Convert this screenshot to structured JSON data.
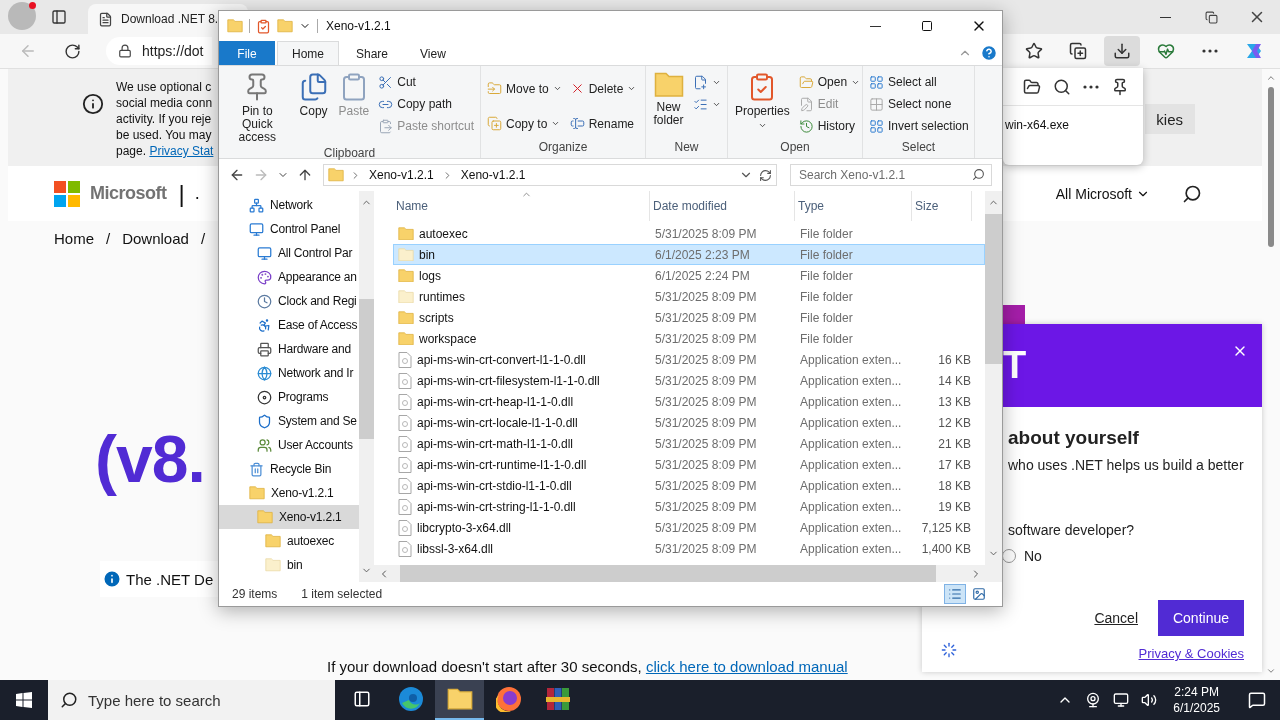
{
  "browser": {
    "tab_title": "Download .NET 8.",
    "url": "https://dot",
    "downloads_open": true
  },
  "downloads_flyout": {
    "file": "win-x64.exe"
  },
  "cookie_banner": {
    "lines": [
      "We use optional c",
      "social media conn",
      "activity. If you reje",
      "be used. You may"
    ],
    "last_line": "page. ",
    "link": "Privacy Stat",
    "button": "kies"
  },
  "site_header": {
    "brand": "Microsoft",
    "divider": "|",
    "product": ".",
    "menu": "All Microsoft"
  },
  "breadcrumb": [
    {
      "label": "Home"
    },
    {
      "label": "Download"
    }
  ],
  "breadcrumb_separator": "/",
  "hero": "(v8.",
  "notice": "The .NET De",
  "download_hint": {
    "text": "If your download doesn't start after 30 seconds, ",
    "link": "click here to download manual"
  },
  "survey": {
    "header": "T",
    "title": "about yourself",
    "intro": "who uses .NET helps us build a better",
    "question": "software developer?",
    "options": [
      {
        "label": "No",
        "selected": false
      }
    ],
    "cancel": "Cancel",
    "continue": "Continue",
    "privacy": "Privacy & Cookies"
  },
  "explorer": {
    "title": "Xeno-v1.2.1",
    "ribbon_tabs": [
      {
        "label": "File",
        "kind": "file",
        "selected": false
      },
      {
        "label": "Home",
        "kind": "tab",
        "selected": true
      },
      {
        "label": "Share",
        "kind": "tab",
        "selected": false
      },
      {
        "label": "View",
        "kind": "tab",
        "selected": false
      }
    ],
    "ribbon_groups": [
      {
        "label": "Clipboard",
        "items": [
          {
            "label": "Pin to Quick access",
            "kind": "large",
            "disabled": false
          },
          {
            "label": "Copy",
            "kind": "large",
            "disabled": false
          },
          {
            "label": "Paste",
            "kind": "large",
            "disabled": true
          },
          {
            "label": "Cut",
            "kind": "small",
            "disabled": false
          },
          {
            "label": "Copy path",
            "kind": "small",
            "disabled": false
          },
          {
            "label": "Paste shortcut",
            "kind": "small",
            "disabled": true
          }
        ]
      },
      {
        "label": "Organize",
        "items": [
          {
            "label": "Move to",
            "kind": "small",
            "disabled": false,
            "dropdown": true
          },
          {
            "label": "Copy to",
            "kind": "small",
            "disabled": false,
            "dropdown": true
          },
          {
            "label": "Delete",
            "kind": "small",
            "disabled": false,
            "dropdown": true
          },
          {
            "label": "Rename",
            "kind": "small",
            "disabled": false
          }
        ]
      },
      {
        "label": "New",
        "items": [
          {
            "label": "New folder",
            "kind": "large",
            "disabled": false
          },
          {
            "kind": "icon",
            "disabled": false,
            "dropdown": true
          },
          {
            "kind": "icon",
            "disabled": false,
            "dropdown": true
          }
        ]
      },
      {
        "label": "Open",
        "items": [
          {
            "label": "Properties",
            "kind": "large",
            "disabled": false,
            "dropdown": true
          },
          {
            "label": "Open",
            "kind": "small",
            "disabled": false,
            "dropdown": true
          },
          {
            "label": "Edit",
            "kind": "small",
            "disabled": true
          },
          {
            "label": "History",
            "kind": "small",
            "disabled": false
          }
        ]
      },
      {
        "label": "Select",
        "items": [
          {
            "label": "Select all",
            "kind": "small",
            "disabled": false
          },
          {
            "label": "Select none",
            "kind": "small",
            "disabled": false
          },
          {
            "label": "Invert selection",
            "kind": "small",
            "disabled": false
          }
        ]
      }
    ],
    "path": [
      "Xeno-v1.2.1",
      "Xeno-v1.2.1"
    ],
    "search_placeholder": "Search Xeno-v1.2.1",
    "nav": [
      {
        "label": "Network",
        "kind": "network",
        "selected": false
      },
      {
        "label": "Control Panel",
        "kind": "panel",
        "selected": false,
        "children": [
          {
            "label": "All Control Par",
            "kind": "panel",
            "selected": false
          },
          {
            "label": "Appearance an",
            "kind": "appearance",
            "selected": false
          },
          {
            "label": "Clock and Regi",
            "kind": "clock",
            "selected": false
          },
          {
            "label": "Ease of Access",
            "kind": "access",
            "selected": false
          },
          {
            "label": "Hardware and",
            "kind": "hardware",
            "selected": false
          },
          {
            "label": "Network and Ir",
            "kind": "internet",
            "selected": false
          },
          {
            "label": "Programs",
            "kind": "programs",
            "selected": false
          },
          {
            "label": "System and Se",
            "kind": "security",
            "selected": false
          },
          {
            "label": "User Accounts",
            "kind": "users",
            "selected": false
          }
        ]
      },
      {
        "label": "Recycle Bin",
        "kind": "recycle",
        "selected": false
      },
      {
        "label": "Xeno-v1.2.1",
        "kind": "folder",
        "selected": false,
        "hidden": false,
        "children": [
          {
            "label": "Xeno-v1.2.1",
            "kind": "folder",
            "selected": true,
            "hidden": false,
            "children": [
              {
                "label": "autoexec",
                "kind": "folder",
                "selected": false,
                "hidden": false
              },
              {
                "label": "bin",
                "kind": "folder",
                "selected": false,
                "hidden": true
              }
            ]
          }
        ]
      }
    ],
    "columns": [
      {
        "label": "Name",
        "sorted": true
      },
      {
        "label": "Date modified",
        "sorted": false
      },
      {
        "label": "Type",
        "sorted": false
      },
      {
        "label": "Size",
        "sorted": false
      }
    ],
    "files": [
      {
        "name": "autoexec",
        "date": "5/31/2025 8:09 PM",
        "type": "File folder",
        "kind": "folder",
        "selected": false,
        "hidden": false
      },
      {
        "name": "bin",
        "date": "6/1/2025 2:23 PM",
        "type": "File folder",
        "kind": "folder",
        "selected": true,
        "hidden": true
      },
      {
        "name": "logs",
        "date": "6/1/2025 2:24 PM",
        "type": "File folder",
        "kind": "folder",
        "selected": false,
        "hidden": false
      },
      {
        "name": "runtimes",
        "date": "5/31/2025 8:09 PM",
        "type": "File folder",
        "kind": "folder",
        "selected": false,
        "hidden": true
      },
      {
        "name": "scripts",
        "date": "5/31/2025 8:09 PM",
        "type": "File folder",
        "kind": "folder",
        "selected": false,
        "hidden": false
      },
      {
        "name": "workspace",
        "date": "5/31/2025 8:09 PM",
        "type": "File folder",
        "kind": "folder",
        "selected": false,
        "hidden": false
      },
      {
        "name": "api-ms-win-crt-convert-l1-1-0.dll",
        "date": "5/31/2025 8:09 PM",
        "type": "Application exten...",
        "size": "16 KB",
        "kind": "file",
        "selected": false
      },
      {
        "name": "api-ms-win-crt-filesystem-l1-1-0.dll",
        "date": "5/31/2025 8:09 PM",
        "type": "Application exten...",
        "size": "14 KB",
        "kind": "file",
        "selected": false
      },
      {
        "name": "api-ms-win-crt-heap-l1-1-0.dll",
        "date": "5/31/2025 8:09 PM",
        "type": "Application exten...",
        "size": "13 KB",
        "kind": "file",
        "selected": false
      },
      {
        "name": "api-ms-win-crt-locale-l1-1-0.dll",
        "date": "5/31/2025 8:09 PM",
        "type": "Application exten...",
        "size": "12 KB",
        "kind": "file",
        "selected": false
      },
      {
        "name": "api-ms-win-crt-math-l1-1-0.dll",
        "date": "5/31/2025 8:09 PM",
        "type": "Application exten...",
        "size": "21 KB",
        "kind": "file",
        "selected": false
      },
      {
        "name": "api-ms-win-crt-runtime-l1-1-0.dll",
        "date": "5/31/2025 8:09 PM",
        "type": "Application exten...",
        "size": "17 KB",
        "kind": "file",
        "selected": false
      },
      {
        "name": "api-ms-win-crt-stdio-l1-1-0.dll",
        "date": "5/31/2025 8:09 PM",
        "type": "Application exten...",
        "size": "18 KB",
        "kind": "file",
        "selected": false
      },
      {
        "name": "api-ms-win-crt-string-l1-1-0.dll",
        "date": "5/31/2025 8:09 PM",
        "type": "Application exten...",
        "size": "19 KB",
        "kind": "file",
        "selected": false
      },
      {
        "name": "libcrypto-3-x64.dll",
        "date": "5/31/2025 8:09 PM",
        "type": "Application exten...",
        "size": "7,125 KB",
        "kind": "file",
        "selected": false
      },
      {
        "name": "libssl-3-x64.dll",
        "date": "5/31/2025 8:09 PM",
        "type": "Application exten...",
        "size": "1,400 KB",
        "kind": "file",
        "selected": false
      }
    ],
    "item_count": "29 items",
    "selection_count": "1 item selected",
    "views": [
      {
        "kind": "details",
        "selected": true
      },
      {
        "kind": "large",
        "selected": false
      }
    ]
  },
  "taskbar": {
    "search_placeholder": "Type here to search",
    "apps": [
      {
        "kind": "edge",
        "selected": false
      },
      {
        "kind": "explorer",
        "selected": true
      },
      {
        "kind": "firefox",
        "selected": false
      },
      {
        "kind": "winrar",
        "selected": false
      }
    ],
    "time": "2:24 PM",
    "date": "6/1/2025"
  }
}
